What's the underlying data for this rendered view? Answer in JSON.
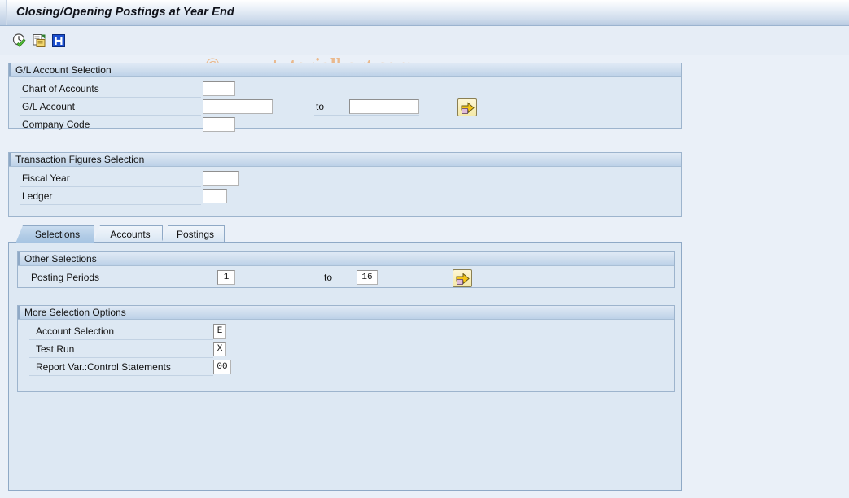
{
  "window": {
    "title": "Closing/Opening Postings at Year End"
  },
  "watermark": {
    "text": "© www.tutorialkart.com",
    "color": "#eab98d"
  },
  "toolbar": {
    "buttons": [
      {
        "name": "execute-icon",
        "tooltip": "Execute"
      },
      {
        "name": "copy-variant-icon",
        "tooltip": "Get Variant"
      },
      {
        "name": "info-icon",
        "tooltip": "Information"
      }
    ]
  },
  "gl_account_selection": {
    "header": "G/L Account Selection",
    "fields": [
      {
        "label": "Chart of Accounts",
        "value": "",
        "to_label": "",
        "to_value": null,
        "multi": false
      },
      {
        "label": "G/L Account",
        "value": "",
        "to_label": "to",
        "to_value": "",
        "multi": true
      },
      {
        "label": "Company Code",
        "value": "",
        "to_label": "",
        "to_value": null,
        "multi": false
      }
    ]
  },
  "transaction_figures_selection": {
    "header": "Transaction Figures Selection",
    "fields": [
      {
        "label": "Fiscal Year",
        "value": ""
      },
      {
        "label": "Ledger",
        "value": ""
      }
    ]
  },
  "tabs": [
    {
      "label": "Selections",
      "active": true
    },
    {
      "label": "Accounts",
      "active": false
    },
    {
      "label": "Postings",
      "active": false
    }
  ],
  "other_selections": {
    "header": "Other Selections",
    "fields": [
      {
        "label": "Posting Periods",
        "value": "1",
        "to_label": "to",
        "to_value": "16",
        "multi": true
      }
    ]
  },
  "more_selection_options": {
    "header": "More Selection Options",
    "fields": [
      {
        "label": "Account Selection",
        "value": "E"
      },
      {
        "label": "Test Run",
        "value": "X"
      },
      {
        "label": "Report Var.:Control Statements",
        "value": "00"
      }
    ]
  },
  "colors": {
    "window_bg": "#eaf0f8",
    "panel_bg": "#dde8f3",
    "panel_border": "#9db4cd",
    "header_gradient_top": "#dfe9f5",
    "header_gradient_bottom": "#bcd1e8",
    "active_tab": "#a6c4e2",
    "input_bg": "#ffffff"
  }
}
